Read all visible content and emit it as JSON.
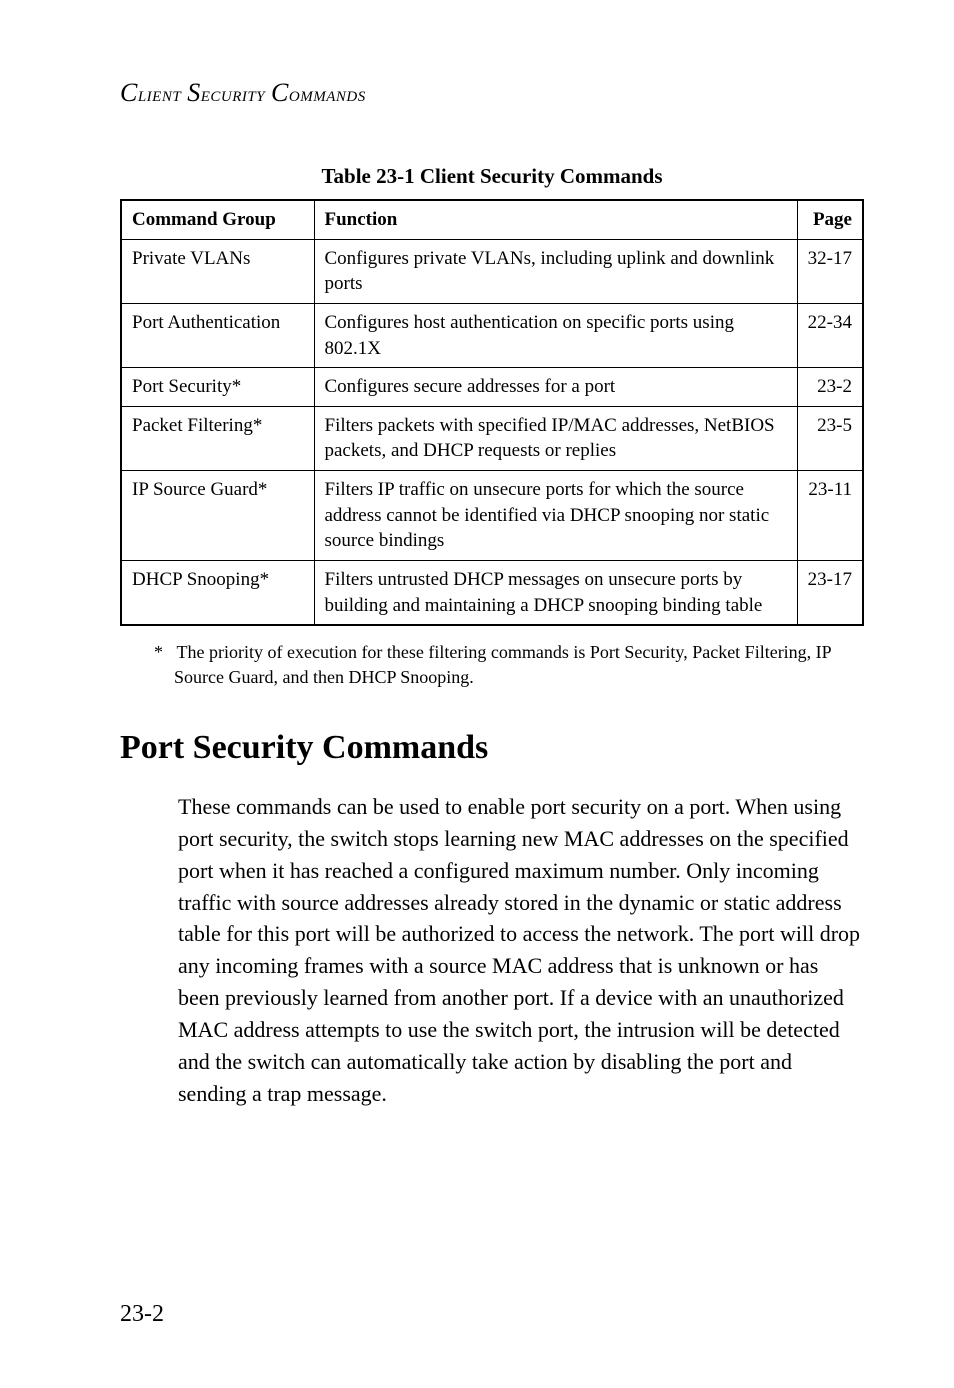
{
  "running_head": "Client Security Commands",
  "table": {
    "caption": "Table 23-1  Client Security Commands",
    "headers": {
      "group": "Command Group",
      "function": "Function",
      "page": "Page"
    },
    "rows": [
      {
        "group": "Private VLANs",
        "function": "Configures private VLANs, including uplink and downlink ports",
        "page": "32-17"
      },
      {
        "group": "Port Authentication",
        "function": "Configures host authentication on specific ports using 802.1X",
        "page": "22-34"
      },
      {
        "group": "Port Security*",
        "function": "Configures secure addresses for a port",
        "page": "23-2"
      },
      {
        "group": "Packet Filtering*",
        "function": "Filters packets with specified IP/MAC addresses, NetBIOS packets, and DHCP requests or replies",
        "page": "23-5"
      },
      {
        "group": "IP Source Guard*",
        "function": "Filters IP traffic on unsecure ports for which the source address cannot be identified via DHCP snooping nor static source bindings",
        "page": "23-11"
      },
      {
        "group": "DHCP Snooping*",
        "function": "Filters untrusted DHCP messages on unsecure ports by building and maintaining a DHCP snooping binding table",
        "page": "23-17"
      }
    ]
  },
  "footnote_marker": "*",
  "footnote": "The priority of execution for these filtering commands is Port Security, Packet Filtering, IP Source Guard, and then DHCP Snooping.",
  "section_heading": "Port Security Commands",
  "body": "These commands can be used to enable port security on a port. When using port security, the switch stops learning new MAC addresses on the specified port when it has reached a configured maximum number. Only incoming traffic with source addresses already stored in the dynamic or static address table for this port will be authorized to access the network. The port will drop any incoming frames with a source MAC address that is unknown or has been previously learned from another port. If a device with an unauthorized MAC address attempts to use the switch port, the intrusion will be detected and the switch can automatically take action by disabling the port and sending a trap message.",
  "page_number": "23-2"
}
